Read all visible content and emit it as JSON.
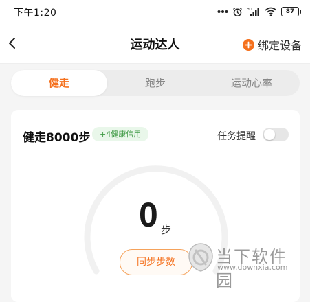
{
  "status_bar": {
    "time": "下午1:20",
    "battery": "87"
  },
  "nav": {
    "title": "运动达人",
    "bind_device": "绑定设备"
  },
  "tabs": [
    {
      "label": "健走",
      "active": true
    },
    {
      "label": "跑步",
      "active": false
    },
    {
      "label": "运动心率",
      "active": false
    }
  ],
  "task": {
    "title": "健走8000步",
    "credit_badge": "+4健康信用",
    "reminder_label": "任务提醒",
    "reminder_on": false,
    "steps": "0",
    "unit": "步",
    "progress_fraction": 0,
    "sync_button": "同步步数"
  },
  "watermark": {
    "name": "当下软件园",
    "url": "www.downxia.com"
  },
  "colors": {
    "accent": "#f5711e",
    "badge_green": "#3e9a44"
  }
}
